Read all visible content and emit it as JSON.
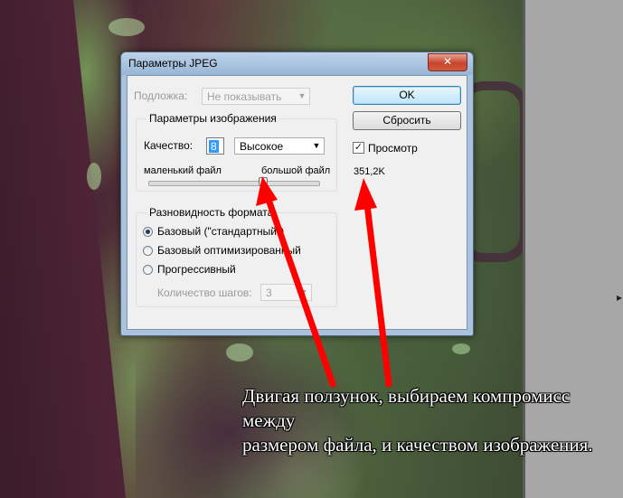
{
  "dialog": {
    "title": "Параметры JPEG",
    "close_label": "✕",
    "matte": {
      "label": "Подложка:",
      "value": "Не показывать"
    },
    "image_options": {
      "legend": "Параметры изображения",
      "quality_label": "Качество:",
      "quality_value": "8",
      "quality_preset": "Высокое",
      "small_file": "маленький файл",
      "large_file": "большой файл",
      "slider_value": 8,
      "slider_max": 12
    },
    "format_options": {
      "legend": "Разновидность формата",
      "options": [
        {
          "label": "Базовый (\"стандартный\")",
          "checked": true
        },
        {
          "label": "Базовый оптимизированный",
          "checked": false
        },
        {
          "label": "Прогрессивный",
          "checked": false
        }
      ],
      "scans_label": "Количество шагов:",
      "scans_value": "3"
    },
    "buttons": {
      "ok": "OK",
      "reset": "Сбросить"
    },
    "preview": {
      "label": "Просмотр",
      "checked": true,
      "size": "351,2K"
    }
  },
  "annotation": {
    "line1": "Двигая ползунок, выбираем компромисс между",
    "line2": "размером файла, и качеством изображения.",
    "arrow_color": "#ff0000"
  },
  "right_panel": {
    "arrow_glyph": "▸"
  }
}
